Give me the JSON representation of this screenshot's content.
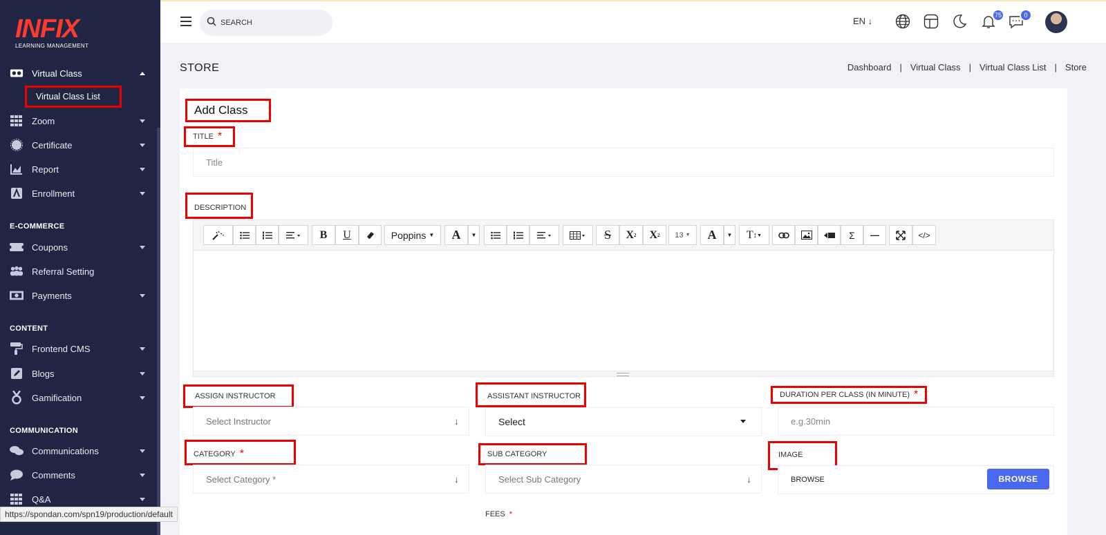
{
  "logo": {
    "main": "INFIX",
    "sub": "LEARNING MANAGEMENT"
  },
  "sidebar": {
    "items": [
      {
        "label": "Virtual Class",
        "icon": "vr-headset-icon"
      },
      {
        "label": "Zoom",
        "icon": "grid-icon"
      },
      {
        "label": "Certificate",
        "icon": "certificate-icon"
      },
      {
        "label": "Report",
        "icon": "chart-icon"
      },
      {
        "label": "Enrollment",
        "icon": "enrollment-icon"
      },
      {
        "label": "Coupons",
        "icon": "coupon-icon"
      },
      {
        "label": "Referral Setting",
        "icon": "users-icon"
      },
      {
        "label": "Payments",
        "icon": "money-icon"
      },
      {
        "label": "Frontend CMS",
        "icon": "paint-roller-icon"
      },
      {
        "label": "Blogs",
        "icon": "edit-icon"
      },
      {
        "label": "Gamification",
        "icon": "medal-icon"
      },
      {
        "label": "Communications",
        "icon": "chat-icon"
      },
      {
        "label": "Comments",
        "icon": "comment-icon"
      },
      {
        "label": "Q&A",
        "icon": "grid-icon"
      }
    ],
    "sub_item": "Virtual Class List",
    "sections": {
      "ecommerce": "E-COMMERCE",
      "content": "CONTENT",
      "communication": "COMMUNICATION"
    }
  },
  "status_url": "https://spondan.com/spn19/production/default",
  "header": {
    "search_placeholder": "SEARCH",
    "lang": "EN ↓",
    "notifications_count": "75",
    "messages_count": "0"
  },
  "page": {
    "title": "STORE",
    "breadcrumb": [
      "Dashboard",
      "Virtual Class",
      "Virtual Class List",
      "Store"
    ]
  },
  "form": {
    "card_title": "Add Class",
    "title_label": "TITLE",
    "title_placeholder": "Title",
    "description_label": "DESCRIPTION",
    "assign_instructor_label": "ASSIGN INSTRUCTOR",
    "assign_instructor_value": "Select Instructor",
    "assistant_instructor_label": "ASSISTANT INSTRUCTOR",
    "assistant_instructor_value": "Select",
    "duration_label": "DURATION PER CLASS (IN MINUTE)",
    "duration_placeholder": "e.g.30min",
    "category_label": "CATEGORY",
    "category_value": "Select Category *",
    "sub_category_label": "SUB CATEGORY",
    "sub_category_value": "Select Sub Category",
    "image_label": "IMAGE",
    "image_value": "BROWSE",
    "browse_button": "BROWSE",
    "fees_label": "FEES",
    "required_mark": "*"
  },
  "editor_toolbar": {
    "font_name": "Poppins",
    "font_size": "13",
    "bold": "B",
    "underline": "U",
    "font_color": "A",
    "strike": "S",
    "superscript": "X",
    "subscript": "X",
    "text_height": "T",
    "sigma": "Σ",
    "dash": "—",
    "code": "</>"
  },
  "colors": {
    "sidebar_bg": "#202543",
    "accent": "#4a67f0",
    "highlight": "#ee0000"
  }
}
